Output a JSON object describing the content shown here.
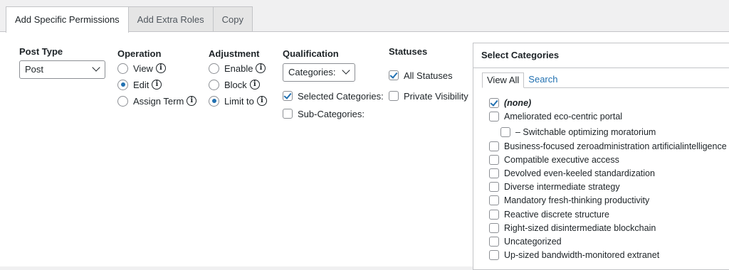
{
  "tabs": [
    "Add Specific Permissions",
    "Add Extra Roles",
    "Copy"
  ],
  "post_type": {
    "label": "Post Type",
    "value": "Post"
  },
  "operation": {
    "label": "Operation",
    "options": [
      {
        "label": "View",
        "checked": false
      },
      {
        "label": "Edit",
        "checked": true
      },
      {
        "label": "Assign Term",
        "checked": false
      }
    ]
  },
  "adjustment": {
    "label": "Adjustment",
    "options": [
      {
        "label": "Enable",
        "checked": false
      },
      {
        "label": "Block",
        "checked": false
      },
      {
        "label": "Limit to",
        "checked": true
      }
    ]
  },
  "qualification": {
    "label": "Qualification",
    "select_value": "Categories:",
    "options": [
      {
        "label": "Selected Categories:",
        "checked": true
      },
      {
        "label": "Sub-Categories:",
        "checked": false
      }
    ]
  },
  "statuses": {
    "label": "Statuses",
    "options": [
      {
        "label": "All Statuses",
        "checked": true
      },
      {
        "label": "Private Visibility",
        "checked": false
      }
    ]
  },
  "categories_box": {
    "title": "Select Categories",
    "tabs": [
      "View All",
      "Search"
    ],
    "items": [
      {
        "label": "(none)",
        "checked": true
      },
      {
        "label": "Ameliorated eco-centric portal",
        "checked": false
      },
      {
        "label": "– Switchable optimizing moratorium",
        "checked": false
      },
      {
        "label": "Business-focused zeroadministration artificialintelligence",
        "checked": false
      },
      {
        "label": "Compatible executive access",
        "checked": false
      },
      {
        "label": "Devolved even-keeled standardization",
        "checked": false
      },
      {
        "label": "Diverse intermediate strategy",
        "checked": false
      },
      {
        "label": "Mandatory fresh-thinking productivity",
        "checked": false
      },
      {
        "label": "Reactive discrete structure",
        "checked": false
      },
      {
        "label": "Right-sized disintermediate blockchain",
        "checked": false
      },
      {
        "label": "Uncategorized",
        "checked": false
      },
      {
        "label": "Up-sized bandwidth-monitored extranet",
        "checked": false
      }
    ]
  },
  "info_icon": "info-icon",
  "colors": {
    "accent": "#2271b1",
    "border": "#c3c4c7",
    "background": "#f0f0f1"
  }
}
